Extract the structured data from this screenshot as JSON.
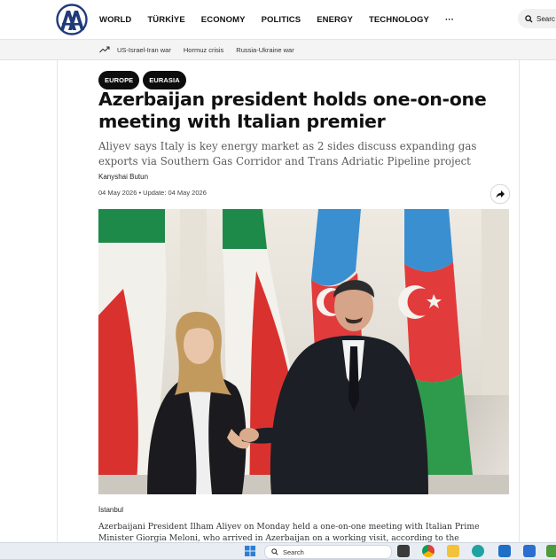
{
  "nav": {
    "items": [
      "WORLD",
      "TÜRKİYE",
      "ECONOMY",
      "POLITICS",
      "ENERGY",
      "TECHNOLOGY"
    ],
    "more": "···",
    "search_label": "Searc"
  },
  "trending": {
    "links": [
      "US-Israel-Iran war",
      "Hormuz crisis",
      "Russia-Ukraine war"
    ]
  },
  "article": {
    "tags": [
      "EUROPE",
      "EURASIA"
    ],
    "headline": "Azerbaijan president holds one-on-one meeting with Italian premier",
    "subtitle": "Aliyev says Italy is key energy market as 2 sides discuss expanding gas exports via Southern Gas Corridor and Trans Adriatic Pipeline project",
    "author": "Kanyshai Butun",
    "dates": "04 May 2026  •  Update: 04 May 2026",
    "dateline": "İstanbul",
    "body": "Azerbaijani President Ilham Aliyev on Monday held a one-on-one meeting with Italian Prime Minister Giorgia Meloni, who arrived in Azerbaijan on a working visit, according to the"
  },
  "taskbar": {
    "search_label": "Search"
  },
  "colors": {
    "accent": "#1f3b7a",
    "tag_bg": "#0d0d0d",
    "italy_green": "#1e8a4a",
    "italy_red": "#d9322e",
    "az_blue": "#3a8fd1",
    "az_red": "#e23b3b",
    "az_green": "#2e9a4c"
  },
  "icons": {
    "logo": "anadolu-agency-logo",
    "search": "search-icon",
    "trending": "trending-icon",
    "share": "share-arrow-icon"
  }
}
